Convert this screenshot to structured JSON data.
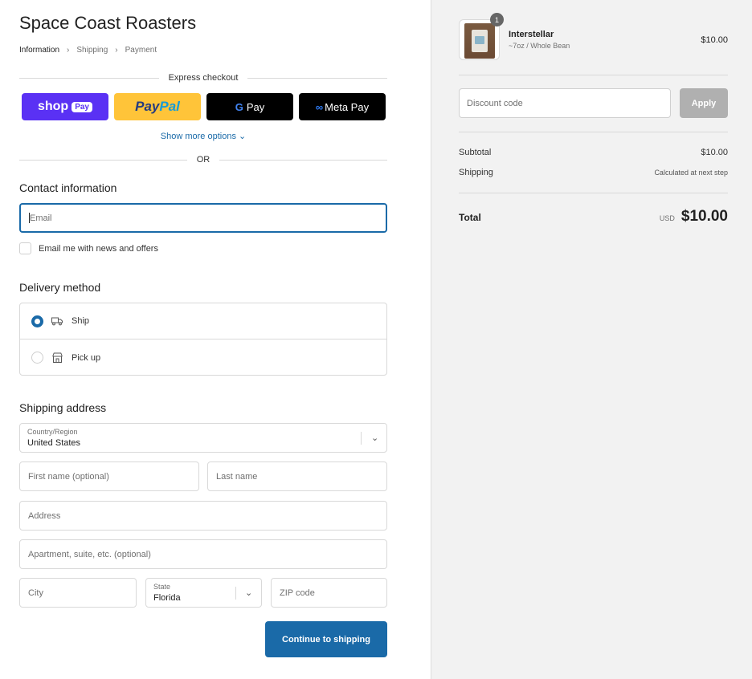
{
  "store": {
    "title": "Space Coast Roasters"
  },
  "breadcrumb": {
    "items": [
      "Information",
      "Shipping",
      "Payment"
    ]
  },
  "express": {
    "label": "Express checkout",
    "shop": "shop",
    "shop_pay": "Pay",
    "paypal_1": "Pay",
    "paypal_2": "Pal",
    "gpay_g": "G",
    "gpay": "Pay",
    "meta_inf": "∞",
    "meta": "Meta Pay",
    "show_more": "Show more options ⌄",
    "or": "OR"
  },
  "contact": {
    "heading": "Contact information",
    "email_placeholder": "Email",
    "news_label": "Email me with news and offers"
  },
  "delivery": {
    "heading": "Delivery method",
    "options": [
      {
        "label": "Ship",
        "selected": true
      },
      {
        "label": "Pick up",
        "selected": false
      }
    ]
  },
  "shipping": {
    "heading": "Shipping address",
    "country_label": "Country/Region",
    "country_value": "United States",
    "first_name": "First name (optional)",
    "last_name": "Last name",
    "address": "Address",
    "apartment": "Apartment, suite, etc. (optional)",
    "city": "City",
    "state_label": "State",
    "state_value": "Florida",
    "zip": "ZIP code",
    "continue": "Continue to shipping"
  },
  "summary": {
    "quantity": "1",
    "product_name": "Interstellar",
    "product_variant": "~7oz / Whole Bean",
    "product_price": "$10.00",
    "discount_placeholder": "Discount code",
    "apply": "Apply",
    "subtotal_label": "Subtotal",
    "subtotal_value": "$10.00",
    "shipping_label": "Shipping",
    "shipping_value": "Calculated at next step",
    "total_label": "Total",
    "currency": "USD",
    "total_value": "$10.00"
  },
  "colors": {
    "accent": "#1a6aa8",
    "shop_pay": "#5a31f4",
    "paypal": "#ffc439",
    "apply_disabled": "#b0b0b0"
  }
}
